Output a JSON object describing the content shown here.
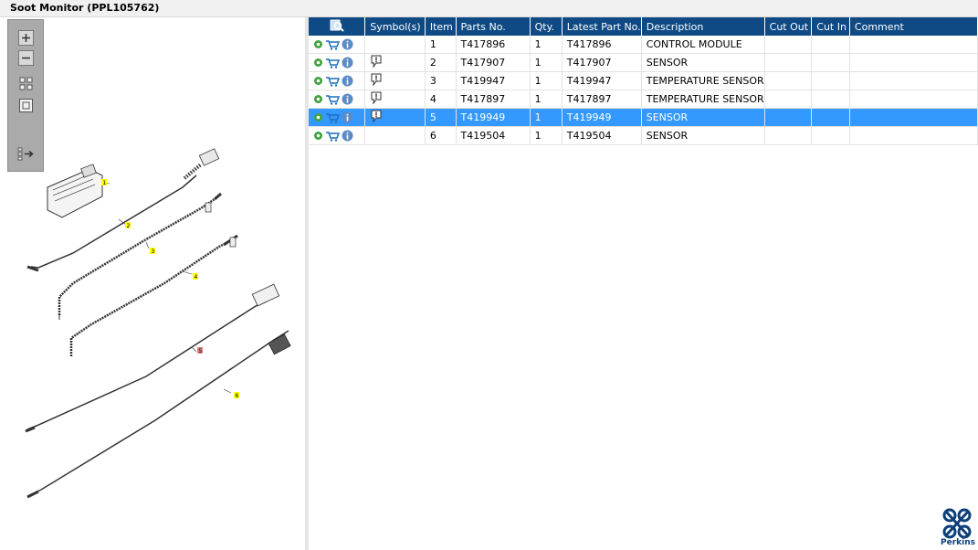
{
  "window": {
    "title": "Soot Monitor (PPL105762)"
  },
  "toolbox": {
    "buttons": [
      "zoom-in",
      "zoom-out",
      "fit-all",
      "actual-size",
      "expand-panel"
    ]
  },
  "drawing": {
    "callouts": [
      "1",
      "2",
      "3",
      "4",
      "5",
      "6"
    ]
  },
  "grid": {
    "columns": [
      "",
      "Symbol(s)",
      "Item",
      "Parts No.",
      "Qty.",
      "Latest Part No.",
      "Description",
      "Cut Out",
      "Cut In",
      "Comment"
    ],
    "rows": [
      {
        "item": "1",
        "parts_no": "T417896",
        "qty": "1",
        "latest": "T417896",
        "description": "CONTROL MODULE",
        "cut_out": "",
        "cut_in": "",
        "comment": "",
        "symbol": false,
        "selected": false
      },
      {
        "item": "2",
        "parts_no": "T417907",
        "qty": "1",
        "latest": "T417907",
        "description": "SENSOR",
        "cut_out": "",
        "cut_in": "",
        "comment": "",
        "symbol": true,
        "selected": false
      },
      {
        "item": "3",
        "parts_no": "T419947",
        "qty": "1",
        "latest": "T419947",
        "description": "TEMPERATURE SENSOR",
        "cut_out": "",
        "cut_in": "",
        "comment": "",
        "symbol": true,
        "selected": false
      },
      {
        "item": "4",
        "parts_no": "T417897",
        "qty": "1",
        "latest": "T417897",
        "description": "TEMPERATURE SENSOR",
        "cut_out": "",
        "cut_in": "",
        "comment": "",
        "symbol": true,
        "selected": false
      },
      {
        "item": "5",
        "parts_no": "T419949",
        "qty": "1",
        "latest": "T419949",
        "description": "SENSOR",
        "cut_out": "",
        "cut_in": "",
        "comment": "",
        "symbol": true,
        "selected": true
      },
      {
        "item": "6",
        "parts_no": "T419504",
        "qty": "1",
        "latest": "T419504",
        "description": "SENSOR",
        "cut_out": "",
        "cut_in": "",
        "comment": "",
        "symbol": false,
        "selected": false
      }
    ]
  },
  "brand": {
    "name": "Perkins",
    "color": "#0d3f7a"
  },
  "colors": {
    "header_bg": "#0f4a84",
    "selected_row": "#3399ff",
    "callout_yellow": "#ffff00",
    "callout_selected": "#e08080"
  }
}
